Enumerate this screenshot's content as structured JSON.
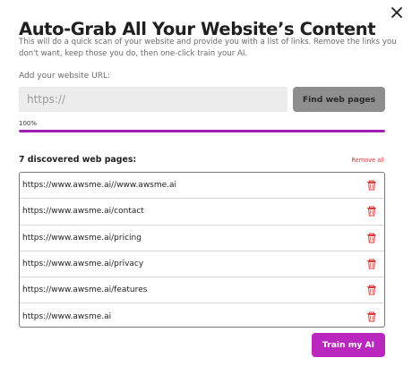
{
  "dialog": {
    "title": "Auto-Grab All Your Website’s Content",
    "subtitle": "This will do a quick scan of your website and provide you with a list of links. Remove the links you don't want, keep those you do, then one-click train your AI.",
    "close_icon": "close-icon"
  },
  "url_form": {
    "label": "Add your website URL:",
    "placeholder": "https://",
    "value": "",
    "find_button_label": "Find web pages"
  },
  "progress": {
    "label": "100%",
    "value": 1.0,
    "color": "#a11fb4"
  },
  "pages": {
    "count_label": "7 discovered web pages:",
    "remove_all_label": "Remove all",
    "remove_color": "#e03a3a",
    "delete_icon": "trash-icon",
    "items": [
      {
        "url": "https://www.awsme.ai//www.awsme.ai"
      },
      {
        "url": "https://www.awsme.ai/contact"
      },
      {
        "url": "https://www.awsme.ai/pricing"
      },
      {
        "url": "https://www.awsme.ai/privacy"
      },
      {
        "url": "https://www.awsme.ai/features"
      },
      {
        "url": "https://www.awsme.ai"
      }
    ]
  },
  "actions": {
    "train_label": "Train my AI",
    "accent": "#ba27bf"
  }
}
